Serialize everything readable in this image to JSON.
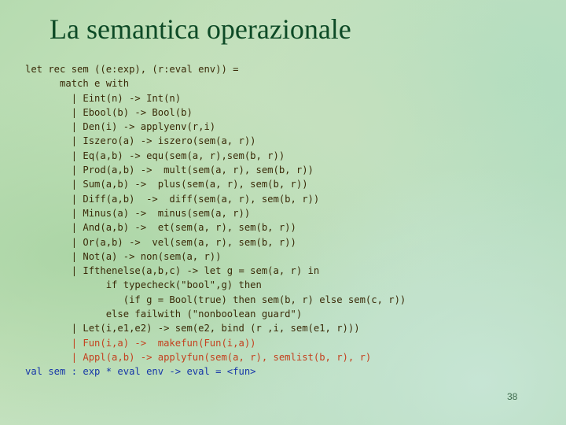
{
  "slide": {
    "title": "La semantica operazionale",
    "page_number": "38",
    "colors": {
      "title": "#0d4a26",
      "code_default": "#3a2a08",
      "code_highlight_red": "#c4401e",
      "code_result_blue": "#1636a8"
    },
    "code_lines": [
      {
        "text": "let rec sem ((e:exp), (r:eval env)) =",
        "color": "default"
      },
      {
        "text": "      match e with",
        "color": "default"
      },
      {
        "text": "        | Eint(n) -> Int(n)",
        "color": "default"
      },
      {
        "text": "        | Ebool(b) -> Bool(b)",
        "color": "default"
      },
      {
        "text": "        | Den(i) -> applyenv(r,i)",
        "color": "default"
      },
      {
        "text": "        | Iszero(a) -> iszero(sem(a, r))",
        "color": "default"
      },
      {
        "text": "        | Eq(a,b) -> equ(sem(a, r),sem(b, r))",
        "color": "default"
      },
      {
        "text": "        | Prod(a,b) ->  mult(sem(a, r), sem(b, r))",
        "color": "default"
      },
      {
        "text": "        | Sum(a,b) ->  plus(sem(a, r), sem(b, r))",
        "color": "default"
      },
      {
        "text": "        | Diff(a,b)  ->  diff(sem(a, r), sem(b, r))",
        "color": "default"
      },
      {
        "text": "        | Minus(a) ->  minus(sem(a, r))",
        "color": "default"
      },
      {
        "text": "        | And(a,b) ->  et(sem(a, r), sem(b, r))",
        "color": "default"
      },
      {
        "text": "        | Or(a,b) ->  vel(sem(a, r), sem(b, r))",
        "color": "default"
      },
      {
        "text": "        | Not(a) -> non(sem(a, r))",
        "color": "default"
      },
      {
        "text": "        | Ifthenelse(a,b,c) -> let g = sem(a, r) in",
        "color": "default"
      },
      {
        "text": "              if typecheck(\"bool\",g) then",
        "color": "default"
      },
      {
        "text": "                 (if g = Bool(true) then sem(b, r) else sem(c, r))",
        "color": "default"
      },
      {
        "text": "              else failwith (\"nonboolean guard\")",
        "color": "default"
      },
      {
        "text": "        | Let(i,e1,e2) -> sem(e2, bind (r ,i, sem(e1, r)))",
        "color": "default"
      },
      {
        "text": "        | Fun(i,a) ->  makefun(Fun(i,a))",
        "color": "red"
      },
      {
        "text": "        | Appl(a,b) -> applyfun(sem(a, r), semlist(b, r), r)",
        "color": "red"
      },
      {
        "text": "val sem : exp * eval env -> eval = <fun>",
        "color": "blue"
      }
    ]
  }
}
